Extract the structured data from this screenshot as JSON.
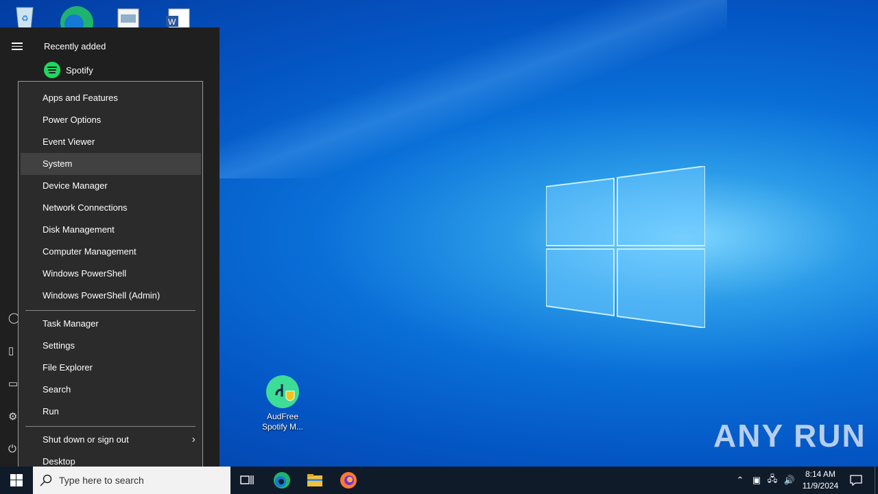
{
  "desktop": {
    "icons_top": [
      "recycle-bin",
      "edge",
      "document",
      "word"
    ],
    "audfree_label_1": "AudFree",
    "audfree_label_2": "Spotify M...",
    "watermark": "ANY RUN"
  },
  "start_menu": {
    "recently_added": "Recently added",
    "app_name": "Spotify"
  },
  "context_menu": {
    "items": [
      "Apps and Features",
      "Power Options",
      "Event Viewer",
      "System",
      "Device Manager",
      "Network Connections",
      "Disk Management",
      "Computer Management",
      "Windows PowerShell",
      "Windows PowerShell (Admin)",
      "Task Manager",
      "Settings",
      "File Explorer",
      "Search",
      "Run",
      "Shut down or sign out",
      "Desktop"
    ],
    "highlighted": "System"
  },
  "taskbar": {
    "search_placeholder": "Type here to search",
    "time": "8:14 AM",
    "date": "11/9/2024"
  },
  "colors": {
    "taskbar": "#101b2a",
    "menu_bg": "#2b2b2b",
    "highlight": "#414141",
    "spotify": "#1ed760"
  }
}
